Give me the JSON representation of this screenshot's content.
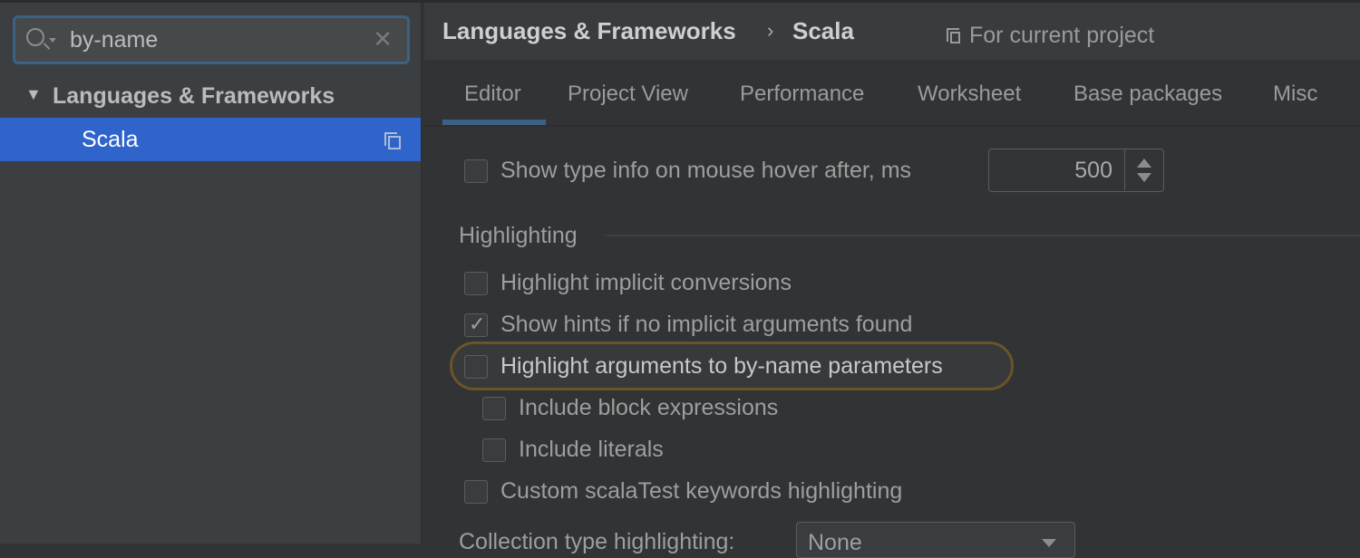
{
  "search": {
    "value": "by-name"
  },
  "tree": {
    "group": "Languages & Frameworks",
    "selected": "Scala"
  },
  "header": {
    "breadcrumb": [
      "Languages & Frameworks",
      "Scala"
    ],
    "scope": "For current project"
  },
  "tabs": [
    "Editor",
    "Project View",
    "Performance",
    "Worksheet",
    "Base packages",
    "Misc"
  ],
  "active_tab": "Editor",
  "hover": {
    "label": "Show type info on mouse hover after, ms",
    "checked": false,
    "value": "500"
  },
  "highlighting": {
    "title": "Highlighting",
    "options": [
      {
        "label": "Highlight implicit conversions",
        "checked": false
      },
      {
        "label": "Show hints if no implicit arguments found",
        "checked": true
      },
      {
        "label": "Highlight arguments to by-name parameters",
        "checked": false
      },
      {
        "label": "Include block expressions",
        "checked": false
      },
      {
        "label": "Include literals",
        "checked": false
      },
      {
        "label": "Custom scalaTest keywords highlighting",
        "checked": false
      }
    ]
  },
  "collection": {
    "label": "Collection type highlighting:",
    "value": "None"
  },
  "colors": {
    "selection": "#2f65ca",
    "focus": "#3d6185",
    "highlight_ring": "#6b5426"
  }
}
